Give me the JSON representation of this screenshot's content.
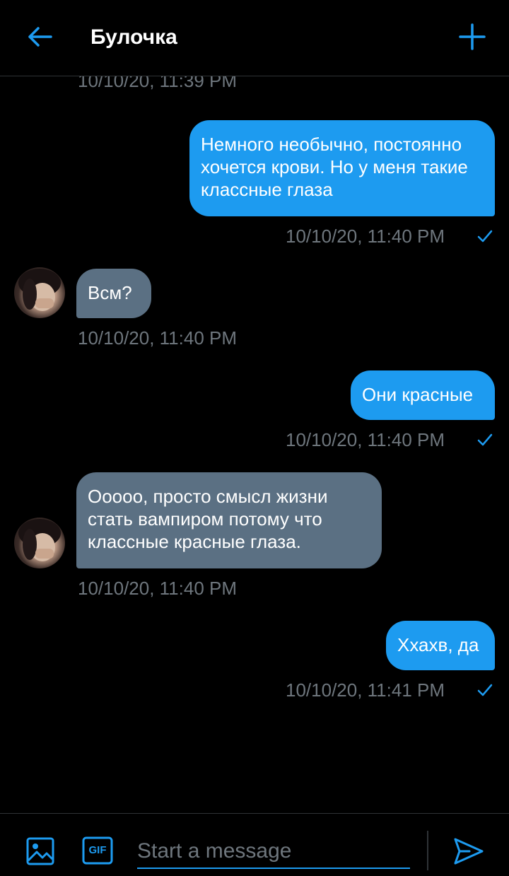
{
  "header": {
    "title": "Булочка",
    "back_icon": "arrow-left-icon",
    "action_icon": "plus-icon"
  },
  "accent_color": "#1d9bf0",
  "received_bubble_color": "#5b7083",
  "messages": {
    "partial_timestamp": "10/10/20, 11:39 PM",
    "items": [
      {
        "direction": "sent",
        "text": "Немного необычно, постоянно хочется крови. Но у меня такие классные глаза",
        "timestamp": "10/10/20, 11:40 PM",
        "read_icon": "check-icon"
      },
      {
        "direction": "received",
        "text": "Всм?",
        "timestamp": "10/10/20, 11:40 PM",
        "avatar": "avatar"
      },
      {
        "direction": "sent",
        "text": "Они красные",
        "timestamp": "10/10/20, 11:40 PM",
        "read_icon": "check-icon"
      },
      {
        "direction": "received",
        "text": "Ооооо, просто смысл жизни стать вампиром потому что классные красные глаза.",
        "timestamp": "10/10/20, 11:40 PM",
        "avatar": "avatar"
      },
      {
        "direction": "sent",
        "text": "Ххахв, да",
        "timestamp": "10/10/20, 11:41 PM",
        "read_icon": "check-icon"
      }
    ]
  },
  "composer": {
    "placeholder": "Start a message",
    "gif_label": "GIF",
    "image_icon": "image-icon",
    "send_icon": "send-icon"
  }
}
